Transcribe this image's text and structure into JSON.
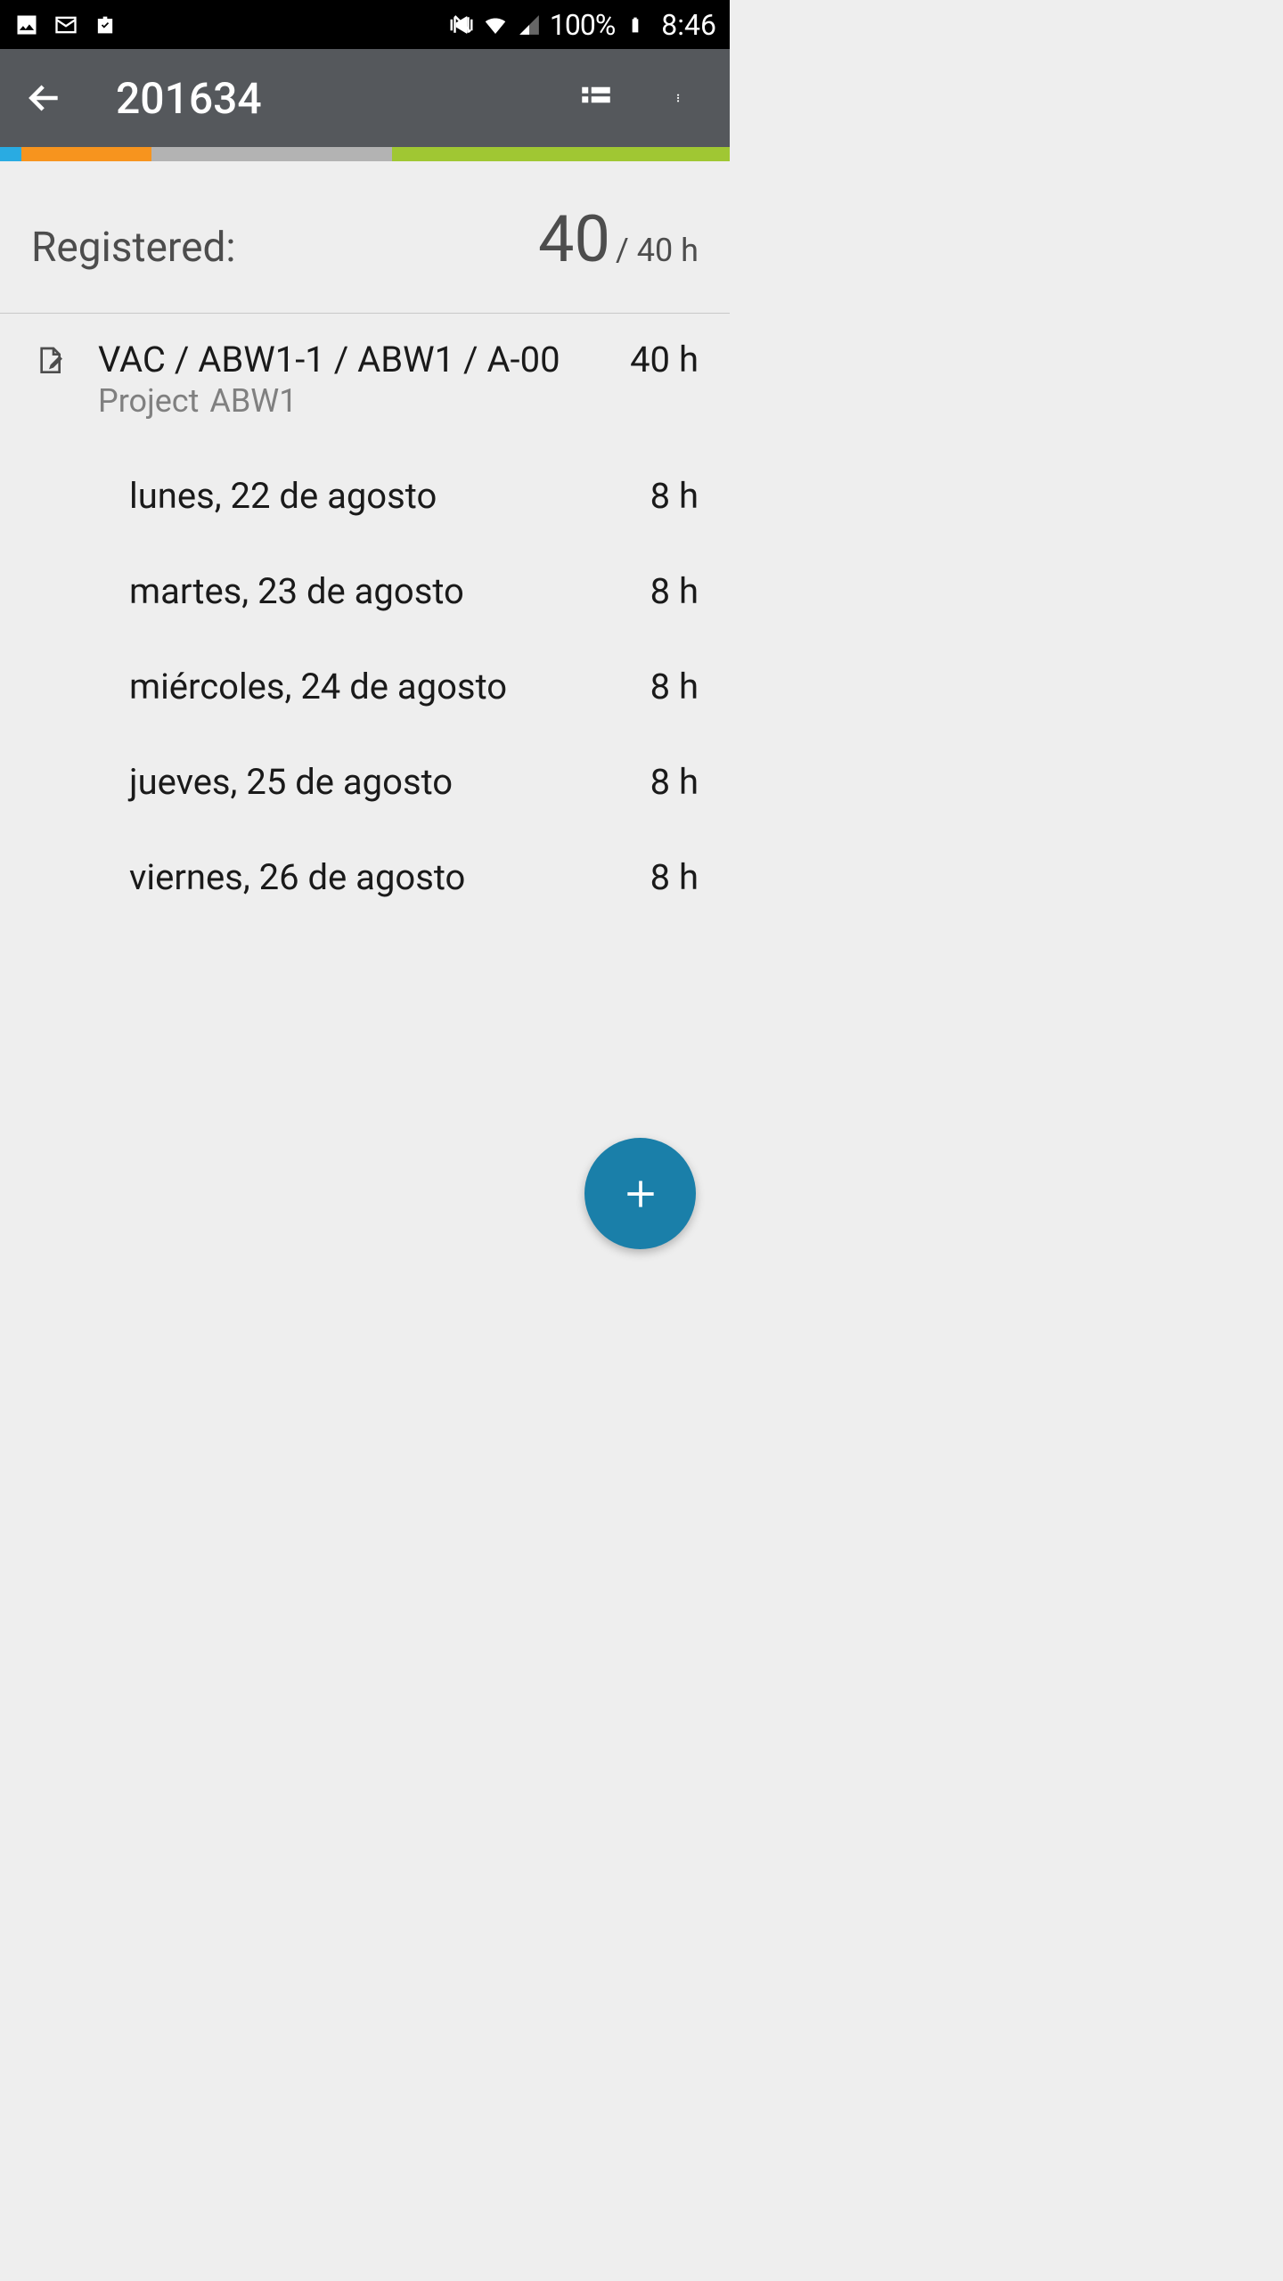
{
  "status": {
    "battery": "100%",
    "clock": "8:46"
  },
  "appbar": {
    "title": "201634"
  },
  "summary": {
    "label": "Registered:",
    "big": "40",
    "small": "/ 40 h"
  },
  "project": {
    "title": "VAC / ABW1-1 / ABW1 / A-00",
    "sub_label": "Project",
    "sub_name": "ABW1",
    "hours": "40 h"
  },
  "days": [
    {
      "label": "lunes, 22 de agosto",
      "hours": "8 h"
    },
    {
      "label": "martes, 23 de agosto",
      "hours": "8 h"
    },
    {
      "label": "miércoles, 24 de agosto",
      "hours": "8 h"
    },
    {
      "label": "jueves, 25 de agosto",
      "hours": "8 h"
    },
    {
      "label": "viernes, 26 de agosto",
      "hours": "8 h"
    }
  ]
}
